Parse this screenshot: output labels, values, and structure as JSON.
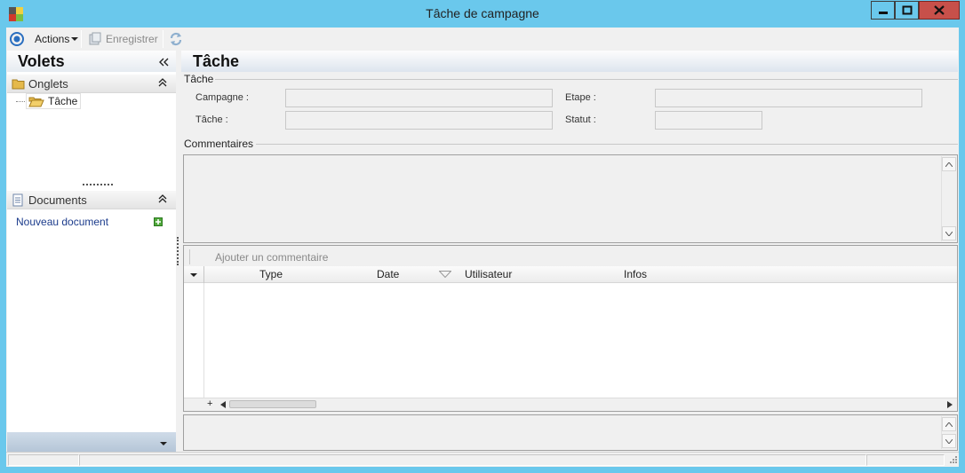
{
  "window": {
    "title": "Tâche de campagne"
  },
  "toolbar": {
    "actions_label": "Actions",
    "save_label": "Enregistrer"
  },
  "left_panel": {
    "title": "Volets",
    "onglets": {
      "label": "Onglets",
      "items": [
        {
          "label": "Tâche"
        }
      ]
    },
    "documents": {
      "label": "Documents",
      "new_document": "Nouveau document"
    }
  },
  "main": {
    "title": "Tâche",
    "task_group": {
      "label": "Tâche",
      "campagne_label": "Campagne :",
      "campagne_value": "",
      "tache_label": "Tâche :",
      "tache_value": "",
      "etape_label": "Etape :",
      "etape_value": "",
      "statut_label": "Statut :",
      "statut_value": ""
    },
    "comments_group": {
      "label": "Commentaires",
      "add_comment": "Ajouter un commentaire",
      "columns": [
        "Type",
        "Date",
        "Utilisateur",
        "Infos"
      ],
      "rows": []
    }
  },
  "colors": {
    "window_frame": "#6ac8ec",
    "close_button": "#c7504a",
    "accent": "#2a6ebf"
  },
  "icons": [
    "app-icon",
    "minimize-icon",
    "maximize-icon",
    "close-icon",
    "actions-circle-icon",
    "save-icon",
    "refresh-icon",
    "collapse-left-icon",
    "folder-icon",
    "folder-open-icon",
    "collapse-up-icon",
    "document-icon",
    "add-icon",
    "scroll-up-icon",
    "scroll-down-icon",
    "dropdown-icon",
    "filter-icon"
  ]
}
